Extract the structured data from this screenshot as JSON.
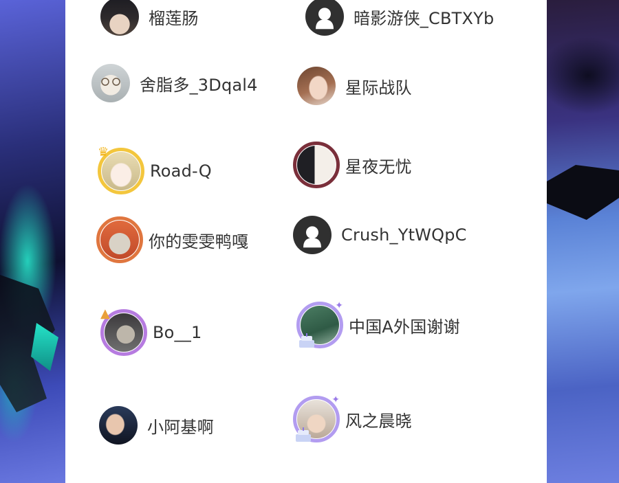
{
  "users": [
    {
      "name": "榴莲肠",
      "avatar": "dark-hair-person-photo"
    },
    {
      "name": "暗影游侠_CBTXYb",
      "avatar": "default-ghost-avatar"
    },
    {
      "name": "舍脂多_3Dqal4",
      "avatar": "glasses-cat-drawing"
    },
    {
      "name": "星际战队",
      "avatar": "brown-hair-girl-photo"
    },
    {
      "name": "Road-Q",
      "avatar": "anime-blonde-crown-frame"
    },
    {
      "name": "星夜无忧",
      "avatar": "anime-duo-frame"
    },
    {
      "name": "你的雯雯鸭嘎",
      "avatar": "fox-hat-animal-frame"
    },
    {
      "name": "Crush_YtWQpC",
      "avatar": "default-ghost-avatar"
    },
    {
      "name": "Bo__1",
      "avatar": "cat-party-frame"
    },
    {
      "name": "中国A外国谢谢",
      "avatar": "green-building-birthday-frame"
    },
    {
      "name": "小阿基啊",
      "avatar": "man-with-microphone-photo"
    },
    {
      "name": "风之晨晓",
      "avatar": "hat-person-birthday-frame"
    }
  ],
  "colors": {
    "panel": "#ffffff",
    "name_text": "#333333",
    "default_avatar": "#303030"
  }
}
